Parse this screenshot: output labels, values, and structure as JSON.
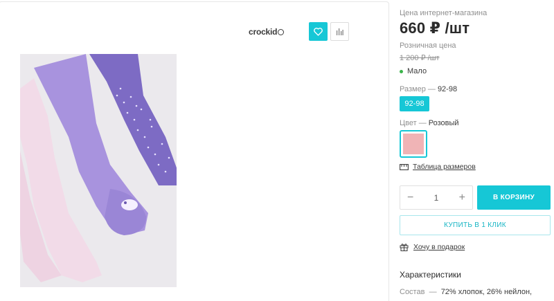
{
  "product": {
    "brand": "crockid",
    "image_alt": "Колготки детские — розовые, сиреневые, фиолетовые в горошек"
  },
  "price": {
    "online_label": "Цена интернет-магазина",
    "online_value": "660 ₽ /шт",
    "retail_label": "Розничная цена",
    "retail_value": "1 200 ₽ /шт"
  },
  "stock": {
    "label": "Мало",
    "color": "#3bb44a"
  },
  "size": {
    "label": "Размер",
    "dash": "—",
    "selected": "92-98",
    "options": [
      "92-98"
    ]
  },
  "color": {
    "label": "Цвет",
    "dash": "—",
    "selected": "Розовый",
    "swatch": "#f0b4b6"
  },
  "size_table": {
    "label": "Таблица размеров",
    "icon": "ruler-icon"
  },
  "quantity": {
    "minus": "−",
    "value": "1",
    "plus": "+"
  },
  "buttons": {
    "cart": "В КОРЗИНУ",
    "one_click": "КУПИТЬ В 1 КЛИК"
  },
  "gift": {
    "label": "Хочу в подарок",
    "icon": "gift-icon"
  },
  "characteristics": {
    "title": "Характеристики",
    "composition_label": "Состав",
    "dash": "—",
    "composition_value": "72% хлопок, 26% нейлон,"
  },
  "colors": {
    "accent": "#16c7d6",
    "text": "#2b2b2b",
    "muted": "#8f8f8f"
  }
}
